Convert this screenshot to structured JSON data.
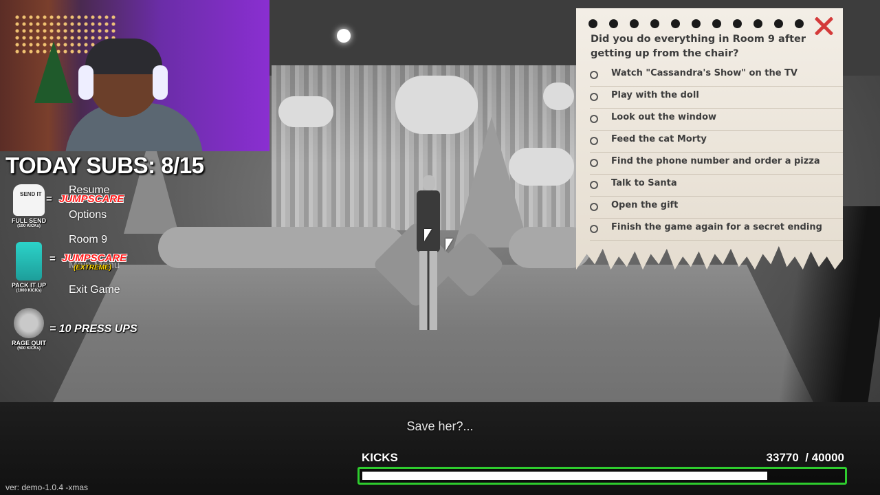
{
  "overlay": {
    "subs_text": "TODAY SUBS: 8/15",
    "rewards": [
      {
        "icon": "full-send-shirt-icon",
        "name": "FULL SEND",
        "cost": "(100 KICKs)",
        "result": "JUMPSCARE",
        "result_sub": ""
      },
      {
        "icon": "pack-it-up-suitcase-icon",
        "name": "PACK IT UP",
        "cost": "(1000 KICKs)",
        "result": "JUMPSCARE",
        "result_sub": "(EXTREME)"
      },
      {
        "icon": "rage-quit-coin-icon",
        "name": "RAGE QUIT",
        "cost": "(500 KICKs)",
        "result": "10 PRESS UPS",
        "result_sub": ""
      }
    ],
    "equals": "="
  },
  "pause_menu": {
    "items": [
      "Resume",
      "Options",
      "Room 9",
      "Exit Game"
    ],
    "ghost_text": "Main Menu"
  },
  "checklist": {
    "question": "Did you do everything in Room 9 after getting up from the chair?",
    "tasks": [
      "Watch \"Cassandra's Show\" on the TV",
      "Play with the doll",
      "Look out the window",
      "Feed the cat Morty",
      "Find the phone number and order a pizza",
      "Talk to Santa",
      "Open the gift",
      "Finish the game again for a secret ending"
    ]
  },
  "hud": {
    "subtitle": "Save her?...",
    "kicks_label": "KICKS",
    "kicks_current": 33770,
    "kicks_goal": 40000,
    "kicks_text": "33770  / 40000",
    "bar_color": "#2ecc2e",
    "version": "ver: demo-1.0.4 -xmas"
  },
  "colors": {
    "jumpscare": "#ff1b1b",
    "extreme": "#ffd600",
    "close": "#d43a3a",
    "note_paper": "#ece6dc"
  }
}
